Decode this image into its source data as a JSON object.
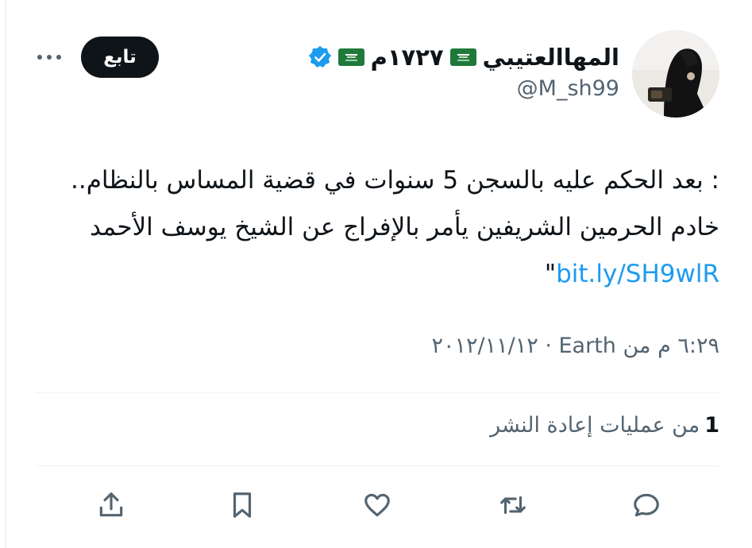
{
  "author": {
    "display_name": "المهاالعتيبي",
    "name_suffix": "١٧٢٧م",
    "handle": "@M_sh99",
    "verified": true,
    "flag_icon": "saudi-flag-icon"
  },
  "follow_button": {
    "label": "تابع"
  },
  "tweet": {
    "text": ": بعد الحكم عليه بالسجن 5 سنوات في قضية المساس بالنظام.. خادم الحرمين الشريفين يأمر بالإفراج عن الشيخ يوسف الأحمد ",
    "link": "bit.ly/SH9wlR",
    "trailing": "\"",
    "timestamp": "٦:٢٩ م من Earth · ٢٠١٢/١١/١٢"
  },
  "stats": {
    "retweet_count": "1",
    "retweet_label": "من عمليات إعادة النشر"
  },
  "actions": [
    {
      "name": "reply-icon"
    },
    {
      "name": "retweet-icon"
    },
    {
      "name": "like-icon"
    },
    {
      "name": "bookmark-icon"
    },
    {
      "name": "share-icon"
    }
  ],
  "colors": {
    "link": "#1d9bf0",
    "verified": "#1d9bf0",
    "secondary_text": "#536471",
    "follow_button_bg": "#0f1419"
  }
}
